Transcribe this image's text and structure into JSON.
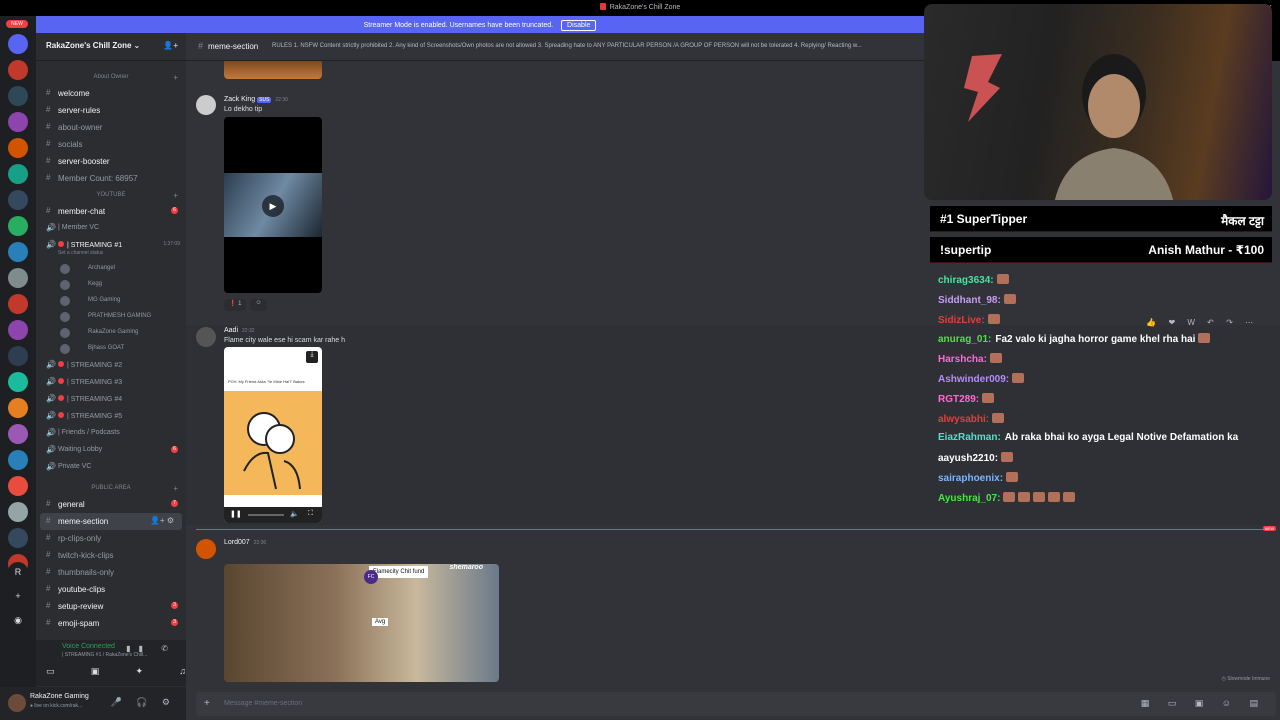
{
  "window": {
    "title": "RakaZone's Chill Zone",
    "close": "×"
  },
  "banner": {
    "text": "Streamer Mode is enabled. Usernames have been truncated.",
    "disable": "Disable"
  },
  "server_rail": {
    "new_badge": "NEW",
    "letter": "R"
  },
  "server": {
    "name": "RakaZone's Chill Zone",
    "chevron": "⌄",
    "invite_icon": "👤+"
  },
  "sidebar": {
    "cat_about": "About Owner",
    "cat_youtube": "YOUTUBE",
    "cat_public": "PUBLIC AREA",
    "channels_about": [
      {
        "name": "welcome",
        "unread": true
      },
      {
        "name": "server-rules",
        "unread": true
      },
      {
        "name": "about-owner",
        "unread": false
      },
      {
        "name": "socials",
        "unread": false
      },
      {
        "name": "server-booster",
        "unread": true
      },
      {
        "name": "Member Count: 68957",
        "unread": false
      }
    ],
    "member_chat": {
      "name": "member-chat",
      "count": "6"
    },
    "member_vc": "| Member VC",
    "streaming_1": {
      "name": "| STREAMING #1",
      "time": "1:37:09",
      "status": "Set a channel status"
    },
    "vc_users": [
      "Archangel",
      "Kegg",
      "MG Gaming",
      "PRATHMESH GAMING",
      "RakaZone Gaming",
      "B​jhass GOAT"
    ],
    "streaming_others": [
      "| STREAMING #2",
      "| STREAMING #3",
      "| STREAMING #4",
      "| STREAMING #5"
    ],
    "friends": "| Friends / Podcasts",
    "waiting": {
      "name": "Waiting Lobby",
      "count": "6"
    },
    "private_vc": "Private VC",
    "public_channels": [
      {
        "name": "general",
        "unread": true,
        "count": "7"
      },
      {
        "name": "meme-section",
        "selected": true
      },
      {
        "name": "rp-clips-only",
        "unread": false
      },
      {
        "name": "twitch-kick-clips",
        "unread": false
      },
      {
        "name": "thumbnails-only",
        "unread": false
      },
      {
        "name": "youtube-clips",
        "unread": true
      },
      {
        "name": "setup-review",
        "unread": true,
        "count": "3"
      },
      {
        "name": "emoji-spam",
        "unread": true,
        "count": "3"
      }
    ]
  },
  "voice_panel": {
    "status": "Voice Connected",
    "channel": "| STREAMING #1 / RakaZone's Chill...",
    "icons": "▮▮ ✆"
  },
  "user_panel": {
    "name": "RakaZone Gaming",
    "status": "● live on kick.com/rak...",
    "controls": "🎤 🎧 ⚙"
  },
  "channel_header": {
    "name": "meme-section",
    "topic": "RULES 1. NSFW Content strictly prohibited 2. Any kind of Screenshots/Own photos are not allowed 3. Spreading hate to ANY PARTICULAR PERSON /A GROUP OF PERSON will not be tolerated 4. Replying/ Reacting w..."
  },
  "messages": [
    {
      "author": "Zack King",
      "tag": "SUS",
      "time": "22:30",
      "text": "Lo dekho tip",
      "reactions": [
        "❗ 1",
        "☺"
      ]
    },
    {
      "author": "Aadi",
      "time": "22:32",
      "text": "Flame city wale ese hi scam kar rahe h",
      "meme_caption": "POV: My Friend Asks 'Ye Mine Hai?' Babes"
    },
    {
      "author": "Lord007",
      "time": "22:36",
      "chit_label": "Flamecity Chit fund",
      "avg_label": "Avg",
      "brand": "shemaroo"
    }
  ],
  "new_divider": "NEW",
  "slowmode": "◷ Slowmode Immune",
  "composer": {
    "placeholder": "Message #meme-section",
    "tools": "▦ ▭ ▣ ☺ ▤"
  },
  "overlay": {
    "supertipper_label": "#1 SuperTipper",
    "supertipper_name": "मैकल टट्टा",
    "supertip_cmd": "!supertip",
    "supertip_value": "Anish Mathur - ₹100",
    "chat_tools": "👍 ❤ W ↶ ↷ ⋯",
    "chat": [
      {
        "user": "chirag3634:",
        "color": "#4be3a0",
        "text": "",
        "emotes": 1
      },
      {
        "user": "Siddhant_98:",
        "color": "#c69cf5",
        "text": "",
        "emotes": 1
      },
      {
        "user": "SidizLive:",
        "color": "#e83c3c",
        "text": "",
        "emotes": 1
      },
      {
        "user": "anurag_01:",
        "color": "#4be34b",
        "text": "Fa2 valo ki jagha horror game khel rha hai",
        "emotes": 1
      },
      {
        "user": "Harshcha:",
        "color": "#ff6ad5",
        "text": "",
        "emotes": 1
      },
      {
        "user": "Ashwinder009:",
        "color": "#b58cff",
        "text": "",
        "emotes": 1
      },
      {
        "user": "RGT289:",
        "color": "#ff6ad5",
        "text": "",
        "emotes": 1
      },
      {
        "user": "alwysabhi:",
        "color": "#e83c3c",
        "text": "",
        "emotes": 1
      },
      {
        "user": "EiazRahman:",
        "color": "#4be3c9",
        "text": "Ab raka bhai ko ayga Legal Notive Defamation ka",
        "emotes": 0
      },
      {
        "user": "aayush2210:",
        "color": "#ffffff",
        "text": "",
        "emotes": 1
      },
      {
        "user": "sairaphoenix:",
        "color": "#7ab5ff",
        "text": "",
        "emotes": 1
      },
      {
        "user": "Ayushraj_07:",
        "color": "#4be34b",
        "text": "",
        "emotes": 5
      }
    ]
  }
}
